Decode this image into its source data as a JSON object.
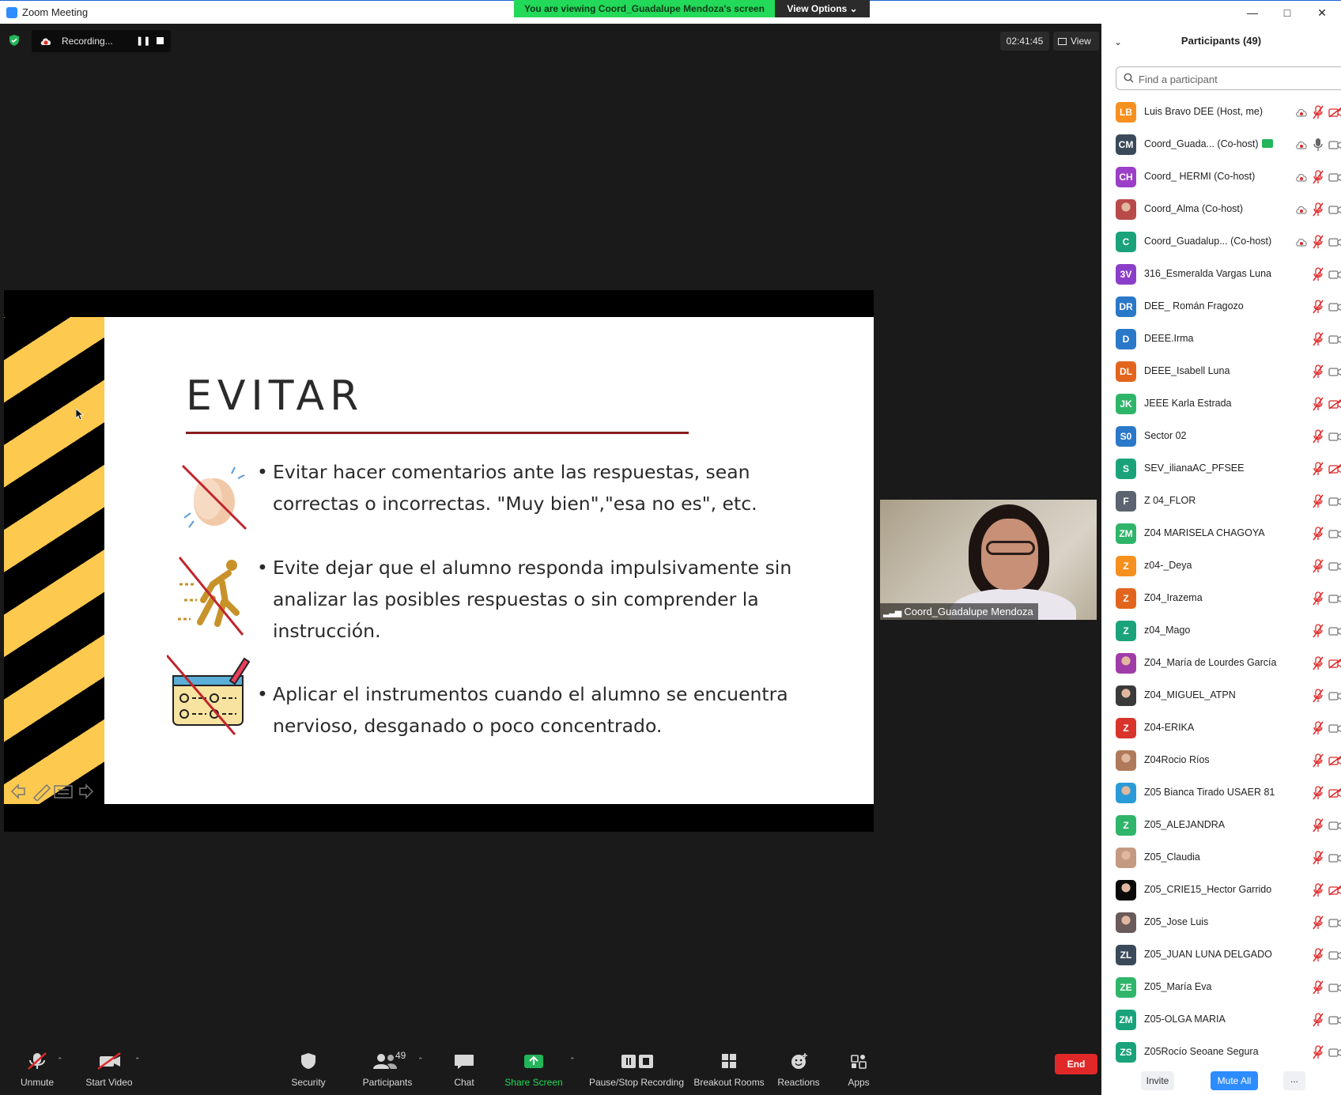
{
  "window": {
    "title": "Zoom Meeting"
  },
  "banner": {
    "viewing": "You are viewing Coord_Guadalupe Mendoza's screen",
    "view_options": "View Options ⌄"
  },
  "recording": {
    "label": "Recording..."
  },
  "timer": "02:41:45",
  "view_button": "View",
  "slide": {
    "title": "EVITAR",
    "bullets": [
      "Evitar hacer comentarios ante las respuestas, sean correctas o incorrectas. \"Muy bien\",\"esa no es\", etc.",
      "Evite dejar que el alumno responda impulsivamente sin analizar las posibles respuestas o sin comprender la instrucción.",
      "Aplicar el instrumentos cuando el alumno se encuentra nervioso, desganado o poco concentrado."
    ]
  },
  "video": {
    "name": "Coord_Guadalupe Mendoza"
  },
  "panel": {
    "title": "Participants (49)",
    "search_placeholder": "Find a participant",
    "invite": "Invite",
    "mute_all": "Mute All",
    "more": "..."
  },
  "colors": {
    "accent": "#2d8cff",
    "end": "#e02828",
    "banner": "#23d959",
    "muted": "#e02828"
  },
  "participants": [
    {
      "initials": "LB",
      "color": "#f6901e",
      "name": "Luis Bravo DEE (Host, me)",
      "cloud": true,
      "mic": "muted",
      "cam": "off"
    },
    {
      "initials": "CM",
      "color": "#3b4a5a",
      "name": "Coord_Guada... (Co-host)",
      "cloud": true,
      "mic": "on",
      "cam": "on",
      "share": true
    },
    {
      "initials": "CH",
      "color": "#9b3fc8",
      "name": "Coord_ HERMI (Co-host)",
      "cloud": true,
      "mic": "muted",
      "cam": "on"
    },
    {
      "initials": "",
      "color": "#b84a4a",
      "name": "Coord_Alma (Co-host)",
      "photo": true,
      "cloud": true,
      "mic": "muted",
      "cam": "on"
    },
    {
      "initials": "C",
      "color": "#1aa37a",
      "name": "Coord_Guadalup... (Co-host)",
      "cloud": true,
      "mic": "muted",
      "cam": "on"
    },
    {
      "initials": "3V",
      "color": "#8b3fc8",
      "name": "316_Esmeralda Vargas Luna",
      "mic": "muted",
      "cam": "on"
    },
    {
      "initials": "DR",
      "color": "#2a78c8",
      "name": "DEE_ Román Fragozo",
      "mic": "muted",
      "cam": "on"
    },
    {
      "initials": "D",
      "color": "#2a78c8",
      "name": "DEEE.Irma",
      "mic": "muted",
      "cam": "on"
    },
    {
      "initials": "DL",
      "color": "#e3651d",
      "name": "DEEE_Isabell Luna",
      "mic": "muted",
      "cam": "on"
    },
    {
      "initials": "JK",
      "color": "#2fb56a",
      "name": "JEEE Karla Estrada",
      "mic": "muted",
      "cam": "off"
    },
    {
      "initials": "S0",
      "color": "#2a78c8",
      "name": "Sector 02",
      "mic": "muted",
      "cam": "on"
    },
    {
      "initials": "S",
      "color": "#1aa37a",
      "name": "SEV_ilianaAC_PFSEE",
      "mic": "muted",
      "cam": "off"
    },
    {
      "initials": "F",
      "color": "#5b6470",
      "name": "Z 04_FLOR",
      "mic": "muted",
      "cam": "on"
    },
    {
      "initials": "ZM",
      "color": "#2fb56a",
      "name": "Z04 MARISELA CHAGOYA",
      "mic": "muted",
      "cam": "on"
    },
    {
      "initials": "Z",
      "color": "#f6901e",
      "name": "z04-_Deya",
      "mic": "muted",
      "cam": "on"
    },
    {
      "initials": "Z",
      "color": "#e3651d",
      "name": "Z04_Irazema",
      "mic": "muted",
      "cam": "on"
    },
    {
      "initials": "Z",
      "color": "#1aa37a",
      "name": "z04_Mago",
      "mic": "muted",
      "cam": "on"
    },
    {
      "initials": "",
      "color": "#a03ca8",
      "name": "Z04_María de Lourdes García",
      "photo": true,
      "mic": "muted",
      "cam": "off"
    },
    {
      "initials": "",
      "color": "#3a3a3a",
      "name": "Z04_MIGUEL_ATPN",
      "photo": true,
      "mic": "muted",
      "cam": "on"
    },
    {
      "initials": "Z",
      "color": "#d9342b",
      "name": "Z04-ERIKA",
      "mic": "muted",
      "cam": "on"
    },
    {
      "initials": "",
      "color": "#b07a5a",
      "name": "Z04Rocio Ríos",
      "photo": true,
      "mic": "muted",
      "cam": "off"
    },
    {
      "initials": "",
      "color": "#2a9bd8",
      "name": "Z05 Bianca Tirado USAER 81",
      "photo": true,
      "mic": "muted",
      "cam": "off"
    },
    {
      "initials": "Z",
      "color": "#2fb56a",
      "name": "Z05_ALEJANDRA",
      "mic": "muted",
      "cam": "on"
    },
    {
      "initials": "",
      "color": "#c49a82",
      "name": "Z05_Claudia",
      "photo": true,
      "mic": "muted",
      "cam": "on"
    },
    {
      "initials": "",
      "color": "#0a0a0a",
      "name": "Z05_CRIE15_Hector Garrido",
      "photo": true,
      "mic": "muted",
      "cam": "off"
    },
    {
      "initials": "",
      "color": "#6a5a5a",
      "name": "Z05_Jose Luis",
      "photo": true,
      "mic": "muted",
      "cam": "on"
    },
    {
      "initials": "ZL",
      "color": "#3b4a5a",
      "name": "Z05_JUAN LUNA DELGADO",
      "mic": "muted",
      "cam": "on"
    },
    {
      "initials": "ZE",
      "color": "#2fb56a",
      "name": "Z05_María Eva",
      "mic": "muted",
      "cam": "on"
    },
    {
      "initials": "ZM",
      "color": "#1aa37a",
      "name": "Z05-OLGA MARIA",
      "mic": "muted",
      "cam": "on"
    },
    {
      "initials": "ZS",
      "color": "#1aa37a",
      "name": "Z05Rocío Seoane Segura",
      "mic": "muted",
      "cam": "on"
    }
  ],
  "toolbar": {
    "unmute": "Unmute",
    "start_video": "Start Video",
    "security": "Security",
    "participants": "Participants",
    "participants_count": "49",
    "chat": "Chat",
    "share_screen": "Share Screen",
    "pause_stop": "Pause/Stop Recording",
    "breakout": "Breakout Rooms",
    "reactions": "Reactions",
    "apps": "Apps",
    "end": "End"
  }
}
